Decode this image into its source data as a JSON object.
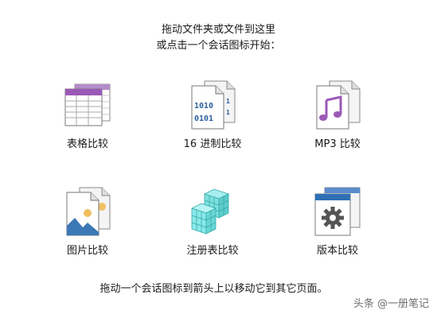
{
  "instructions": {
    "line1": "拖动文件夹或文件到这里",
    "line2": "或点击一个会话图标开始："
  },
  "sessions": [
    {
      "label": "表格比较",
      "icon": "table-compare-icon"
    },
    {
      "label": "16 进制比较",
      "icon": "hex-compare-icon"
    },
    {
      "label": "MP3 比较",
      "icon": "mp3-compare-icon"
    },
    {
      "label": "图片比较",
      "icon": "picture-compare-icon"
    },
    {
      "label": "注册表比较",
      "icon": "registry-compare-icon"
    },
    {
      "label": "版本比较",
      "icon": "version-compare-icon"
    }
  ],
  "footer": "拖动一个会话图标到箭头上以移动它到其它页面。",
  "watermark": "头条 @一册笔记",
  "colors": {
    "table_header": "#9b59b6",
    "hex_text": "#2c5f9e",
    "music_note": "#9b59b6",
    "registry_cube": "#5fd7d7",
    "version_header": "#2f6fb5",
    "gear": "#555555"
  }
}
